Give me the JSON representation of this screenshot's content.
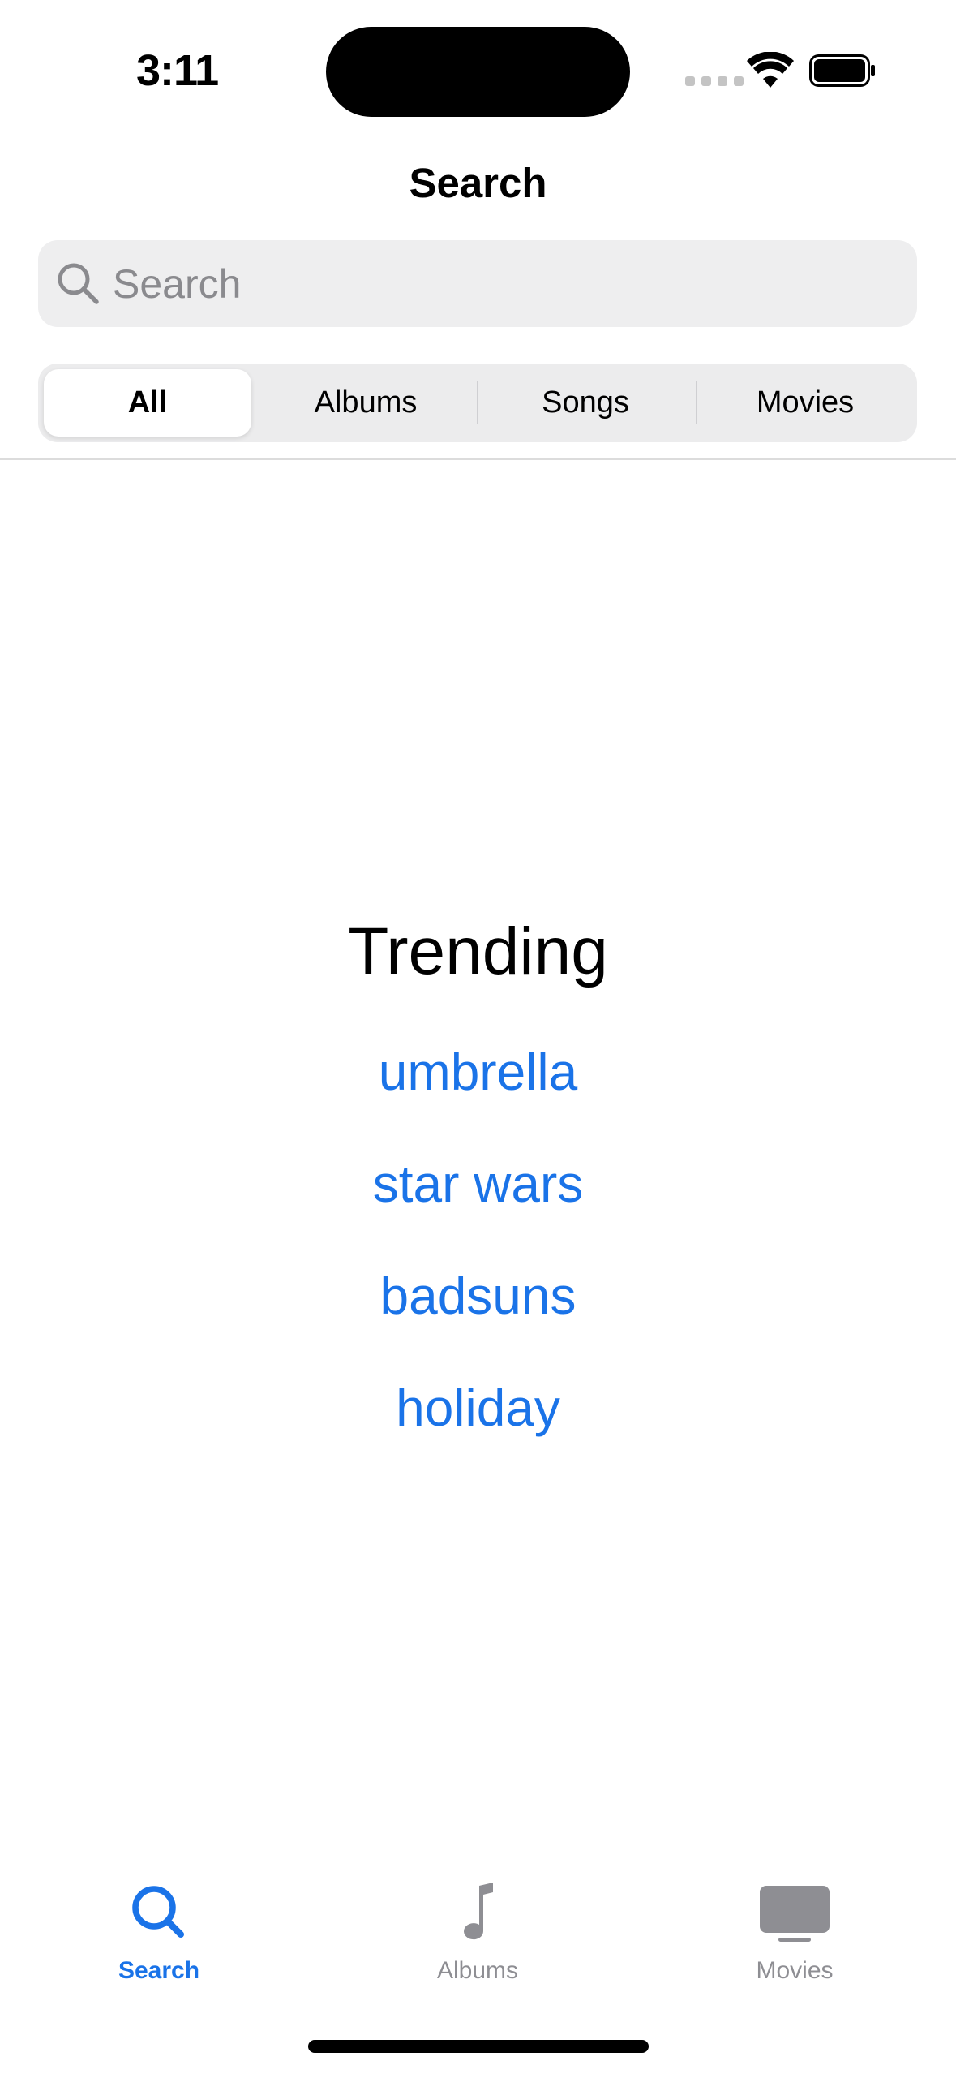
{
  "status_bar": {
    "time": "3:11"
  },
  "nav": {
    "title": "Search"
  },
  "search": {
    "placeholder": "Search",
    "value": ""
  },
  "segments": [
    {
      "label": "All",
      "selected": true
    },
    {
      "label": "Albums",
      "selected": false
    },
    {
      "label": "Songs",
      "selected": false
    },
    {
      "label": "Movies",
      "selected": false
    }
  ],
  "trending": {
    "title": "Trending",
    "items": [
      "umbrella",
      "star wars",
      "badsuns",
      "holiday"
    ]
  },
  "tab_bar": {
    "tabs": [
      {
        "label": "Search",
        "icon": "search-icon",
        "selected": true
      },
      {
        "label": "Albums",
        "icon": "music-note-icon",
        "selected": false
      },
      {
        "label": "Movies",
        "icon": "tv-icon",
        "selected": false
      }
    ]
  },
  "colors": {
    "accent": "#1a73e8",
    "inactive": "#8e8e93",
    "field_bg": "#eeeeef"
  }
}
